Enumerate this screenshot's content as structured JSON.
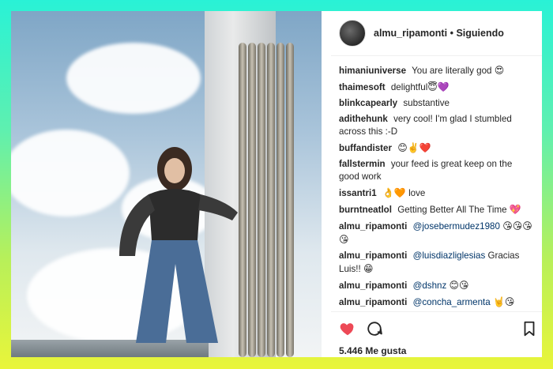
{
  "post": {
    "username": "almu_ripamonti",
    "separator": "•",
    "follow_status": "Siguiendo",
    "likes": "5.446 Me gusta"
  },
  "comments": [
    {
      "user": "himaniuniverse",
      "text": "You are literally god",
      "emoji": "😍"
    },
    {
      "user": "thaimesoft",
      "text": "delightful",
      "emoji": "😇💜"
    },
    {
      "user": "blinkcapearly",
      "text": "substantive",
      "emoji": ""
    },
    {
      "user": "adithehunk",
      "text": "very cool! I'm glad I stumbled across this :-D",
      "emoji": ""
    },
    {
      "user": "buffandister",
      "text": "",
      "emoji": "😊✌️❤️"
    },
    {
      "user": "fallstermin",
      "text": "your feed is great keep on the good work",
      "emoji": ""
    },
    {
      "user": "issantri1",
      "text": "love",
      "emoji_before": "👌🧡"
    },
    {
      "user": "burntneatlol",
      "text": "Getting Better All The Time",
      "emoji": "💖"
    },
    {
      "user": "almu_ripamonti",
      "mention": "@josebermudez1980",
      "emoji": "😘😘😘😘"
    },
    {
      "user": "almu_ripamonti",
      "mention": "@luisdiazliglesias",
      "text": "Gracias Luis!!",
      "emoji": "😁"
    },
    {
      "user": "almu_ripamonti",
      "mention": "@dshnz",
      "emoji": "😊😘"
    },
    {
      "user": "almu_ripamonti",
      "mention": "@concha_armenta",
      "emoji": "🤘😘"
    }
  ],
  "icons": {
    "like": "heart-icon",
    "comment": "comment-icon",
    "save": "bookmark-icon"
  },
  "colors": {
    "like": "#ed4956",
    "text": "#262626",
    "mention": "#003569"
  }
}
